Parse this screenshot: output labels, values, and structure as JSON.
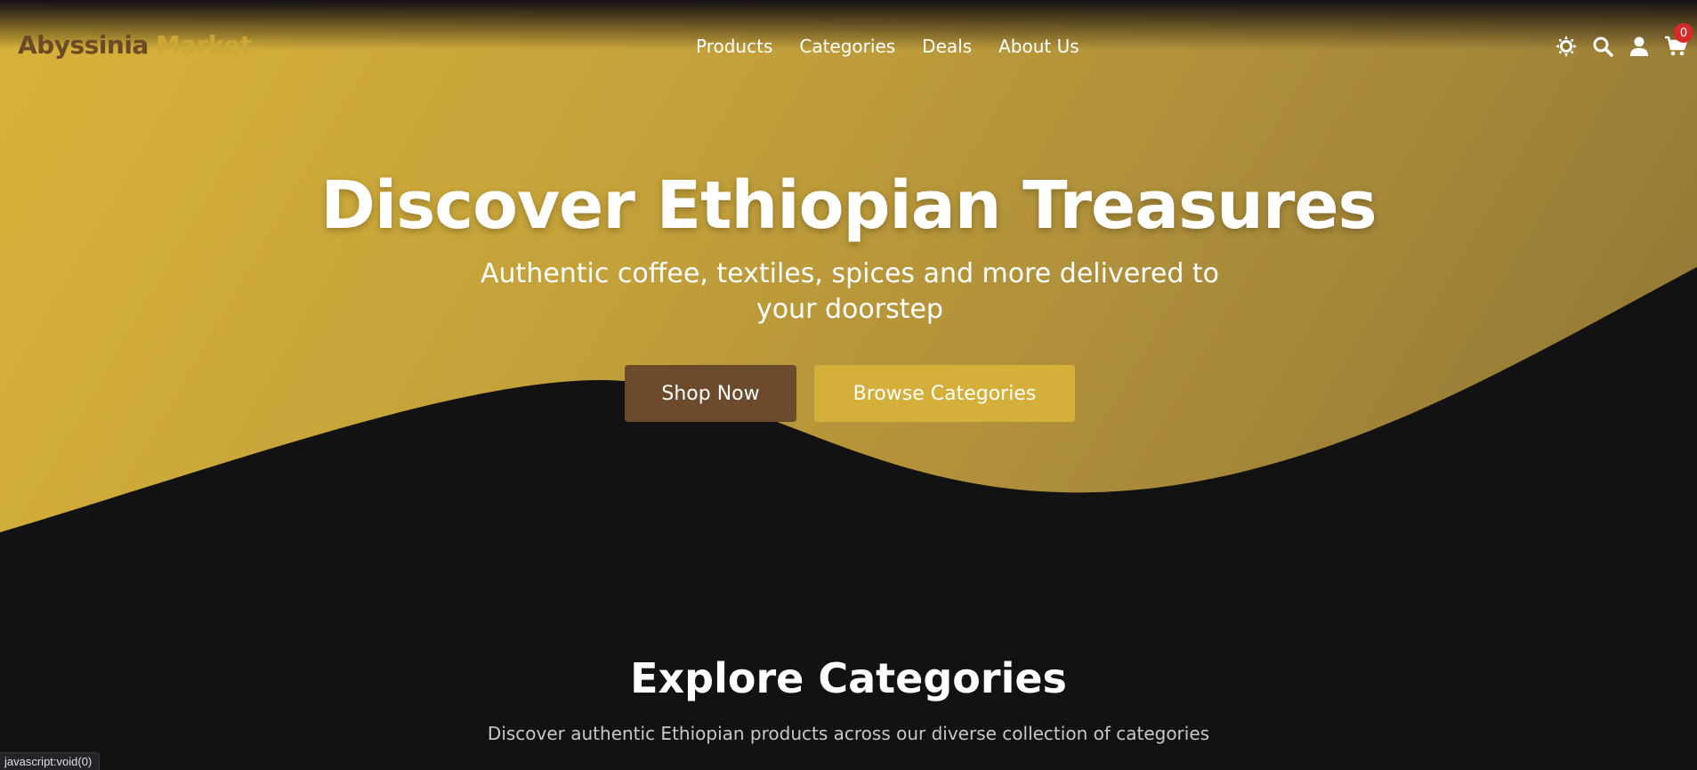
{
  "colors": {
    "gold": "#d4b03a",
    "brown": "#6b4b2b",
    "dark_bg": "#121212",
    "badge_red": "#d62b2b"
  },
  "navbar": {
    "brand_main": "Abyssinia",
    "brand_accent": "Market",
    "links": [
      "Products",
      "Categories",
      "Deals",
      "About Us"
    ],
    "icons": [
      "theme-toggle-icon",
      "search-icon",
      "user-icon",
      "cart-icon"
    ],
    "cart_count": "0"
  },
  "hero": {
    "title": "Discover Ethiopian Treasures",
    "subtitle": "Authentic coffee, textiles, spices and more delivered to your doorstep",
    "shop_button": "Shop Now",
    "browse_button": "Browse Categories"
  },
  "categories_section": {
    "title": "Explore Categories",
    "subtitle": "Discover authentic Ethiopian products across our diverse collection of categories"
  },
  "status_bar": {
    "text": "javascript:void(0)"
  }
}
